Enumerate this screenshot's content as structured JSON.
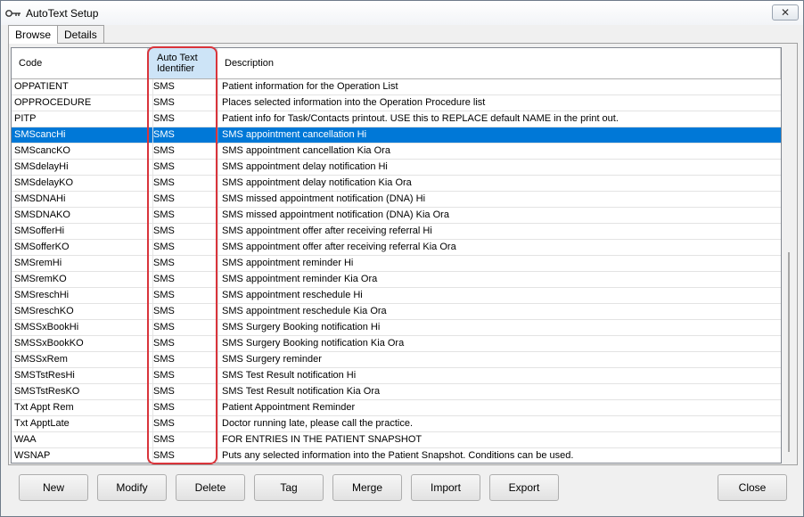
{
  "window": {
    "title": "AutoText Setup",
    "close_glyph": "✕"
  },
  "tabs": [
    {
      "label": "Browse",
      "active": true
    },
    {
      "label": "Details",
      "active": false
    }
  ],
  "table": {
    "headers": {
      "code": "Code",
      "ident_line1": "Auto Text",
      "ident_line2": "Identifier",
      "desc": "Description"
    },
    "rows": [
      {
        "code": "OPPATIENT",
        "ident": "SMS",
        "desc": "Patient information for the Operation List"
      },
      {
        "code": "OPPROCEDURE",
        "ident": "SMS",
        "desc": "Places selected information into the Operation Procedure list"
      },
      {
        "code": "PITP",
        "ident": "SMS",
        "desc": "Patient info for Task/Contacts printout. USE this to REPLACE default NAME in the print out."
      },
      {
        "code": "SMScancHi",
        "ident": "SMS",
        "desc": " SMS appointment cancellation Hi",
        "selected": true
      },
      {
        "code": "SMScancKO",
        "ident": "SMS",
        "desc": " SMS appointment cancellation Kia Ora"
      },
      {
        "code": "SMSdelayHi",
        "ident": "SMS",
        "desc": " SMS appointment delay notification Hi"
      },
      {
        "code": "SMSdelayKO",
        "ident": "SMS",
        "desc": " SMS appointment delay notification Kia Ora"
      },
      {
        "code": "SMSDNAHi",
        "ident": "SMS",
        "desc": " SMS missed appointment notification (DNA) Hi"
      },
      {
        "code": "SMSDNAKO",
        "ident": "SMS",
        "desc": " SMS missed appointment notification (DNA) Kia Ora"
      },
      {
        "code": "SMSofferHi",
        "ident": "SMS",
        "desc": " SMS appointment offer after receiving referral Hi"
      },
      {
        "code": "SMSofferKO",
        "ident": "SMS",
        "desc": " SMS appointment offer after receiving referral Kia Ora"
      },
      {
        "code": "SMSremHi",
        "ident": "SMS",
        "desc": " SMS appointment reminder Hi"
      },
      {
        "code": "SMSremKO",
        "ident": "SMS",
        "desc": " SMS appointment reminder Kia Ora"
      },
      {
        "code": "SMSreschHi",
        "ident": "SMS",
        "desc": " SMS appointment reschedule Hi"
      },
      {
        "code": "SMSreschKO",
        "ident": "SMS",
        "desc": " SMS appointment reschedule Kia Ora"
      },
      {
        "code": "SMSSxBookHi",
        "ident": "SMS",
        "desc": " SMS Surgery Booking notification Hi"
      },
      {
        "code": "SMSSxBookKO",
        "ident": "SMS",
        "desc": " SMS Surgery Booking notification Kia Ora"
      },
      {
        "code": "SMSSxRem",
        "ident": "SMS",
        "desc": " SMS Surgery reminder"
      },
      {
        "code": "SMSTstResHi",
        "ident": "SMS",
        "desc": " SMS Test Result notification Hi"
      },
      {
        "code": "SMSTstResKO",
        "ident": "SMS",
        "desc": " SMS Test Result notification Kia Ora"
      },
      {
        "code": "Txt Appt Rem",
        "ident": "SMS",
        "desc": "Patient Appointment Reminder"
      },
      {
        "code": "Txt ApptLate",
        "ident": "SMS",
        "desc": "Doctor running late, please call the practice."
      },
      {
        "code": "WAA",
        "ident": "SMS",
        "desc": "FOR ENTRIES IN THE PATIENT SNAPSHOT"
      },
      {
        "code": "WSNAP",
        "ident": "SMS",
        "desc": "Puts any selected information into the Patient Snapshot.  Conditions can be used."
      }
    ]
  },
  "buttons": {
    "new": "New",
    "modify": "Modify",
    "delete": "Delete",
    "tag": "Tag",
    "merge": "Merge",
    "import": "Import",
    "export": "Export",
    "close": "Close"
  },
  "colors": {
    "selection": "#0078d7",
    "highlight_border": "#d9343b",
    "header_sorted": "#cde4f7"
  },
  "icons": {
    "title": "keys-icon"
  }
}
